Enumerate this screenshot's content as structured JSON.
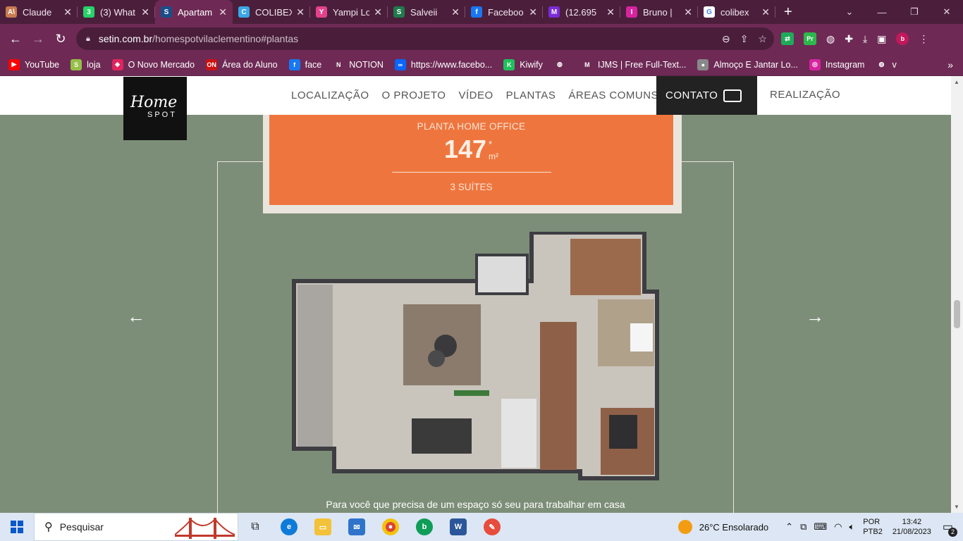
{
  "browser": {
    "tabs": [
      {
        "title": "Claude",
        "color": "#c77b4e",
        "glyph": "A\\"
      },
      {
        "title": "(3) What",
        "color": "#25d366",
        "glyph": "3"
      },
      {
        "title": "Apartam",
        "color": "#1a4e8a",
        "glyph": "S",
        "active": true
      },
      {
        "title": "COLIBEX",
        "color": "#3aa7e8",
        "glyph": "C"
      },
      {
        "title": "Yampi Lo",
        "color": "#e5408c",
        "glyph": "Y"
      },
      {
        "title": "Salveii",
        "color": "#1f7a4d",
        "glyph": "S"
      },
      {
        "title": "Faceboo",
        "color": "#1877f2",
        "glyph": "f"
      },
      {
        "title": "(12.695",
        "color": "#7b2bd8",
        "glyph": "M"
      },
      {
        "title": "Bruno |",
        "color": "#d6249f",
        "glyph": "I"
      },
      {
        "title": "colibex",
        "color": "#ffffff",
        "glyph": "G"
      }
    ],
    "url_domain": "setin.com.br",
    "url_path": "/homespotvilaclementino#plantas",
    "bookmarks": [
      {
        "label": "YouTube",
        "color": "#ff0000",
        "glyph": "▶"
      },
      {
        "label": "loja",
        "color": "#95bf47",
        "glyph": "S"
      },
      {
        "label": "O Novo Mercado",
        "color": "#e0245e",
        "glyph": "◆"
      },
      {
        "label": "Área do Aluno",
        "color": "#cc1111",
        "glyph": "ON"
      },
      {
        "label": "face",
        "color": "#1877f2",
        "glyph": "f"
      },
      {
        "label": "NOTION",
        "color": "#ffffff",
        "glyph": "N"
      },
      {
        "label": "https://www.facebo...",
        "color": "#0866ff",
        "glyph": "∞"
      },
      {
        "label": "Kiwify",
        "color": "#20c05c",
        "glyph": "K"
      },
      {
        "label": "",
        "color": "#ffffff",
        "glyph": "◍"
      },
      {
        "label": "IJMS | Free Full-Text...",
        "color": "#ffffff",
        "glyph": "M"
      },
      {
        "label": "Almoço E Jantar Lo...",
        "color": "#888888",
        "glyph": "●"
      },
      {
        "label": "Instagram",
        "color": "#d6249f",
        "glyph": "◎"
      },
      {
        "label": "v",
        "color": "#ffffff",
        "glyph": "◍"
      }
    ]
  },
  "site": {
    "logo_line1": "Home",
    "logo_line2": "SPOT",
    "menu": [
      "LOCALIZAÇÃO",
      "O PROJETO",
      "VÍDEO",
      "PLANTAS",
      "ÁREAS COMUNS"
    ],
    "contact_label": "CONTATO",
    "realizacao_label": "REALIZAÇÃO"
  },
  "plan": {
    "title": "PLANTA HOME OFFICE",
    "area_value": "147",
    "area_asterisk": "*",
    "area_unit": "m²",
    "suites": "3 SUÍTES",
    "caption": "Para você que precisa de um espaço só seu para trabalhar em casa",
    "prev_arrow": "←",
    "next_arrow": "→"
  },
  "taskbar": {
    "search_placeholder": "Pesquisar",
    "weather": "26°C  Ensolarado",
    "lang_top": "POR",
    "lang_bottom": "PTB2",
    "time": "13:42",
    "date": "21/08/2023",
    "notif_count": "2"
  }
}
